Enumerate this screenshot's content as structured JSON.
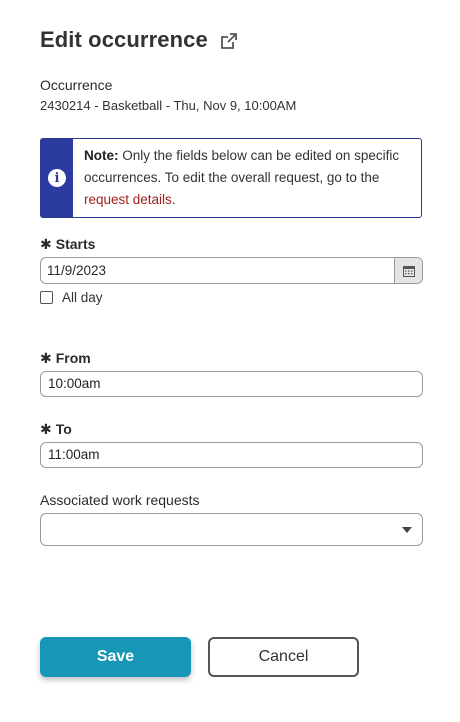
{
  "header": {
    "title": "Edit occurrence"
  },
  "occurrence": {
    "label": "Occurrence",
    "value": "2430214 - Basketball - Thu, Nov 9, 10:00AM"
  },
  "note": {
    "prefix": "Note:",
    "body": " Only the fields below can be edited on specific occurrences. To edit the overall request, go to the ",
    "link": "request details",
    "suffix": "."
  },
  "starts": {
    "required_mark": "✱",
    "label": "Starts",
    "value": "11/9/2023"
  },
  "all_day": {
    "label": "All day",
    "checked": false
  },
  "from": {
    "required_mark": "✱",
    "label": "From",
    "value": "10:00am"
  },
  "to": {
    "required_mark": "✱",
    "label": "To",
    "value": "11:00am"
  },
  "work_requests": {
    "label": "Associated work requests",
    "value": ""
  },
  "buttons": {
    "save": "Save",
    "cancel": "Cancel"
  },
  "colors": {
    "primary": "#1796b8",
    "note_accent": "#2b3b9f",
    "link": "#a02020"
  }
}
